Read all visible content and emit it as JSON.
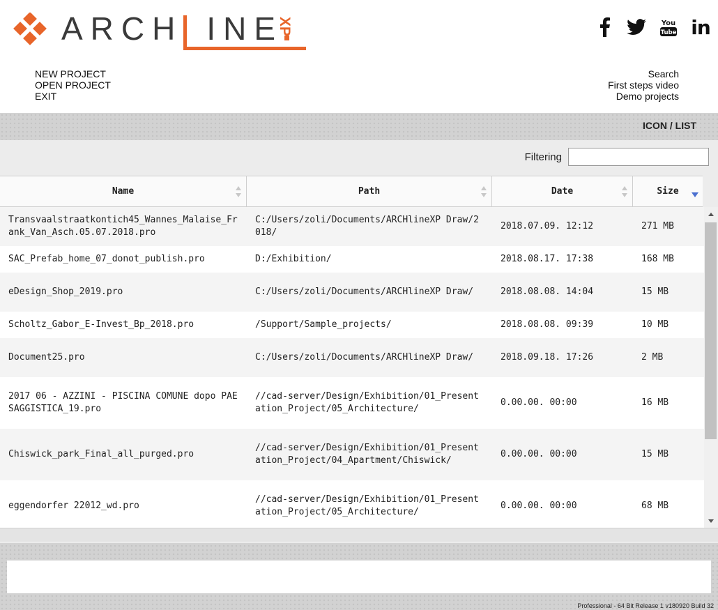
{
  "header": {
    "logo_text": "ARCH",
    "logo_text2": "INE",
    "logo_suffix": "XP",
    "social": [
      "facebook-icon",
      "twitter-icon",
      "youtube-icon",
      "linkedin-icon"
    ],
    "youtube_top": "You",
    "youtube_bottom": "Tube",
    "linkedin_text": "in"
  },
  "menu_left": [
    "NEW PROJECT",
    "OPEN PROJECT",
    "EXIT"
  ],
  "menu_right": [
    "Search",
    "First steps video",
    "Demo projects"
  ],
  "view_toggle": "ICON / LIST",
  "filter": {
    "label": "Filtering",
    "value": "",
    "placeholder": ""
  },
  "table": {
    "columns": [
      "Name",
      "Path",
      "Date",
      "Size"
    ],
    "sorted_by": "Size",
    "rows": [
      {
        "name": "Transvaalstraatkontich45_Wannes_Malaise_Frank_Van_Asch.05.07.2018.pro",
        "path": "C:/Users/zoli/Documents/ARCHlineXP Draw/2018/",
        "date": "2018.07.09. 12:12",
        "size": "271 MB"
      },
      {
        "name": "SAC_Prefab_home_07_donot_publish.pro",
        "path": "D:/Exhibition/",
        "date": "2018.08.17. 17:38",
        "size": "168 MB"
      },
      {
        "name": "eDesign_Shop_2019.pro",
        "path": "C:/Users/zoli/Documents/ARCHlineXP Draw/",
        "date": "2018.08.08. 14:04",
        "size": "15 MB"
      },
      {
        "name": "Scholtz_Gabor_E-Invest_Bp_2018.pro",
        "path": "/Support/Sample_projects/",
        "date": "2018.08.08. 09:39",
        "size": "10 MB"
      },
      {
        "name": "Document25.pro",
        "path": "C:/Users/zoli/Documents/ARCHlineXP Draw/",
        "date": "2018.09.18. 17:26",
        "size": "2 MB"
      },
      {
        "name": "2017 06 - AZZINI - PISCINA COMUNE dopo PAESAGGISTICA_19.pro",
        "path": "//cad-server/Design/Exhibition/01_Presentation_Project/05_Architecture/",
        "date": "0.00.00. 00:00",
        "size": "16 MB"
      },
      {
        "name": "Chiswick_park_Final_all_purged.pro",
        "path": "//cad-server/Design/Exhibition/01_Presentation_Project/04_Apartment/Chiswick/",
        "date": "0.00.00. 00:00",
        "size": "15 MB"
      },
      {
        "name": "eggendorfer 22012_wd.pro",
        "path": "//cad-server/Design/Exhibition/01_Presentation_Project/05_Architecture/",
        "date": "0.00.00. 00:00",
        "size": "68 MB"
      }
    ]
  },
  "version": "Professional - 64 Bit Release 1 v180920 Build 32",
  "colors": {
    "brand_orange": "#e8652a",
    "logo_grey": "#3a3a3a",
    "sort_active": "#4a6fd0"
  }
}
